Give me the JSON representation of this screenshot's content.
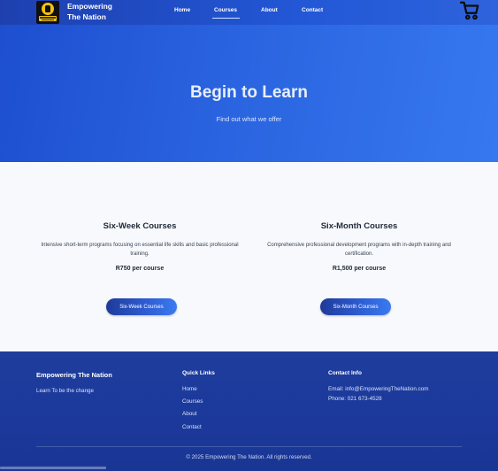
{
  "header": {
    "brand_line1": "Empowering",
    "brand_line2": "The Nation",
    "nav": {
      "home": "Home",
      "courses": "Courses",
      "about": "About",
      "contact": "Contact"
    },
    "active_nav": "Courses",
    "cart_icon": "shopping-cart-icon",
    "logo_icon": "raised-fist-logo-icon"
  },
  "hero": {
    "title": "Begin to Learn",
    "subtitle": "Find out what we offer"
  },
  "courses": {
    "cards": [
      {
        "title": "Six-Week Courses",
        "description": "Intensive short-term programs focusing on essential life skills and basic professional training.",
        "price": "R750 per course",
        "button": "Six-Week Courses"
      },
      {
        "title": "Six-Month Courses",
        "description": "Comprehensive professional development programs with in-depth training and certification.",
        "price": "R1,500 per course",
        "button": "Six-Month Courses"
      }
    ]
  },
  "footer": {
    "brand": "Empowering The Nation",
    "tagline": "Learn To be the change",
    "quick_links_title": "Quick Links",
    "quick_links": [
      "Home",
      "Courses",
      "About",
      "Contact"
    ],
    "contact_title": "Contact Info",
    "email": "Email: info@EmpoweringTheNation.com",
    "phone": "Phone: 021 673-4528",
    "copyright": "© 2025 Empowering The Nation. All rights reserved."
  },
  "colors": {
    "primary": "#1e40af",
    "hero_gradient_end": "#3678f0",
    "logo_yellow": "#f4c20d",
    "section_bg": "#f7f9fc"
  }
}
